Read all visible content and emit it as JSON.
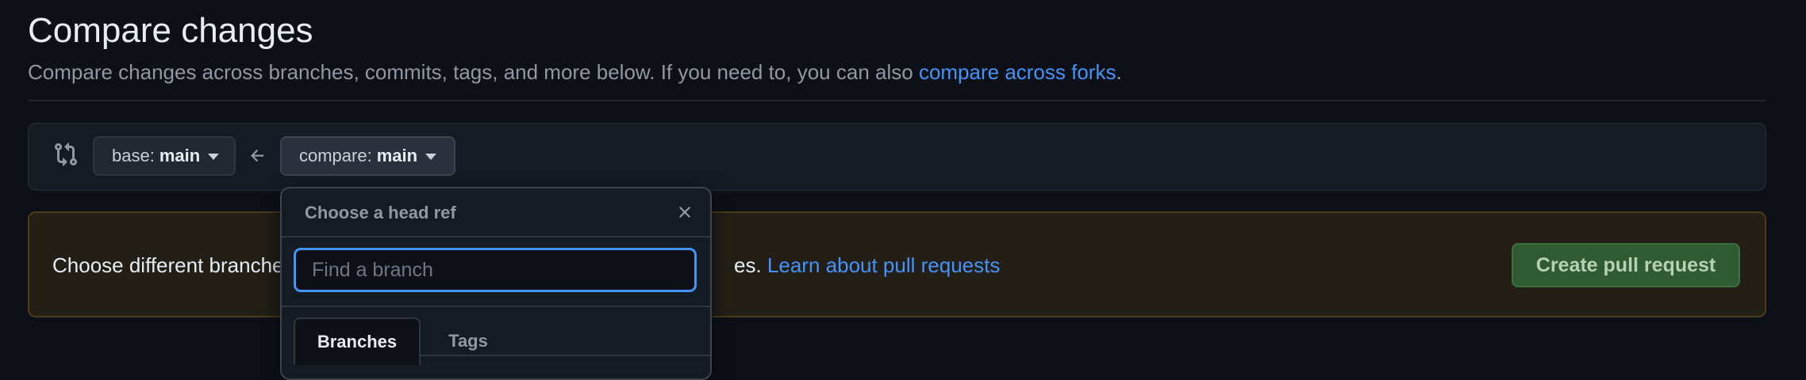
{
  "header": {
    "title": "Compare changes",
    "subtitle_prefix": "Compare changes across branches, commits, tags, and more below. If you need to, you can also ",
    "subtitle_link": "compare across forks",
    "subtitle_suffix": "."
  },
  "range": {
    "icon": "git-compare-icon",
    "base_label": "base:",
    "base_value": "main",
    "arrow_icon": "arrow-left-icon",
    "head_label": "compare:",
    "head_value": "main"
  },
  "notice": {
    "text": "Choose different branche",
    "link_prefix": "es. ",
    "link": "Learn about pull requests",
    "create_button": "Create pull request"
  },
  "dropdown": {
    "title": "Choose a head ref",
    "close_icon": "close-icon",
    "search_placeholder": "Find a branch",
    "tabs": [
      "Branches",
      "Tags"
    ],
    "active_tab": "Branches"
  },
  "colors": {
    "background": "#0d1117",
    "link": "#4493f8",
    "create_button_bg": "#2f5a32"
  }
}
